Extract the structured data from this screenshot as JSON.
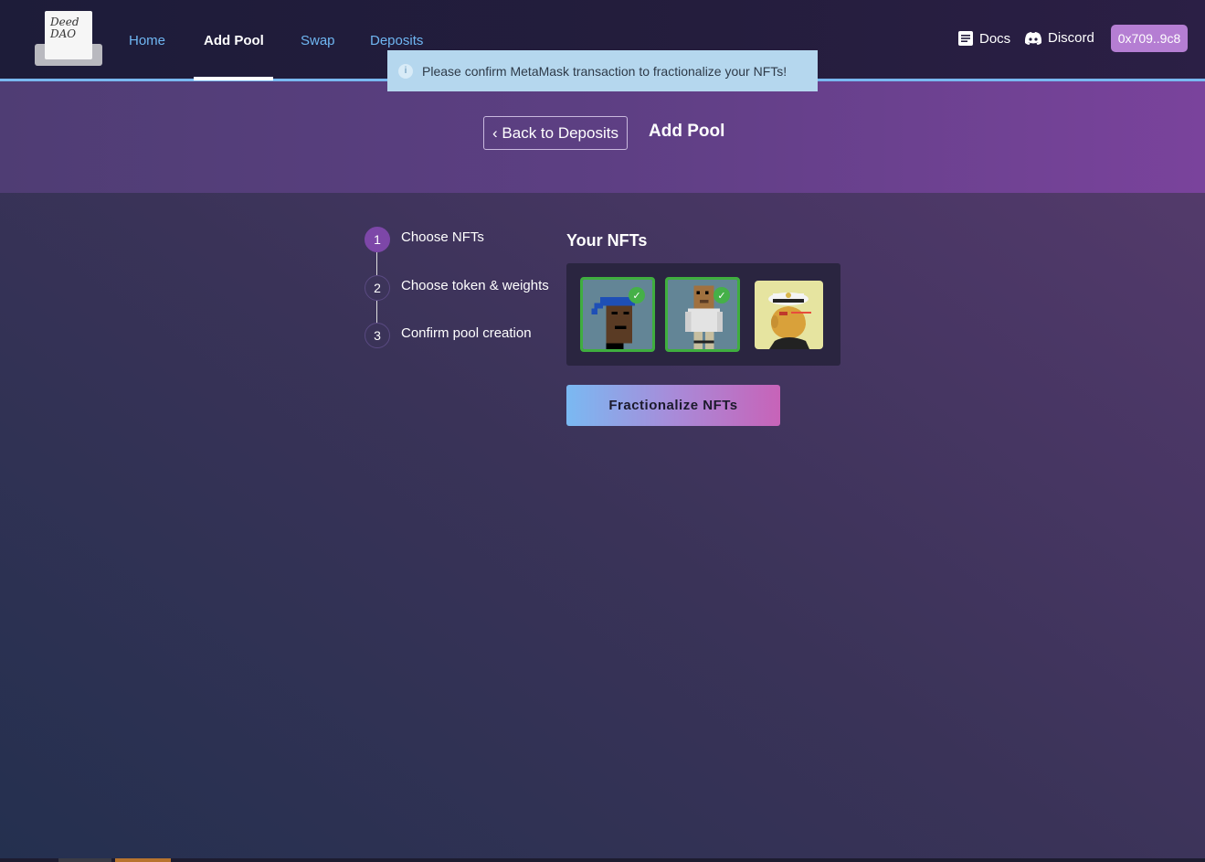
{
  "navbar": {
    "logo_text": "Deed DAO",
    "links": [
      {
        "label": "Home",
        "active": false
      },
      {
        "label": "Add Pool",
        "active": true
      },
      {
        "label": "Swap",
        "active": false
      },
      {
        "label": "Deposits",
        "active": false
      }
    ],
    "docs_label": "Docs",
    "discord_label": "Discord",
    "wallet_address": "0x709..9c8"
  },
  "toast": {
    "message": "Please confirm MetaMask transaction to fractionalize your NFTs!",
    "icon": "info-icon"
  },
  "header": {
    "back_label": "‹ Back to Deposits",
    "title": "Add Pool"
  },
  "stepper": {
    "steps": [
      {
        "number": "1",
        "label": "Choose NFTs",
        "active": true
      },
      {
        "number": "2",
        "label": "Choose token & weights",
        "active": false
      },
      {
        "number": "3",
        "label": "Confirm pool creation",
        "active": false
      }
    ]
  },
  "nfts": {
    "title": "Your NFTs",
    "items": [
      {
        "name": "punk-bandana",
        "selected": true
      },
      {
        "name": "punk-box-head",
        "selected": true
      },
      {
        "name": "ape-captain",
        "selected": false
      }
    ]
  },
  "actions": {
    "fractionalize_label": "Fractionalize NFTs"
  },
  "colors": {
    "accent_blue": "#79b8f0",
    "wallet_bg": "#b57ed3",
    "step_active": "#7d47a8",
    "selected_border": "#3fae3f"
  }
}
